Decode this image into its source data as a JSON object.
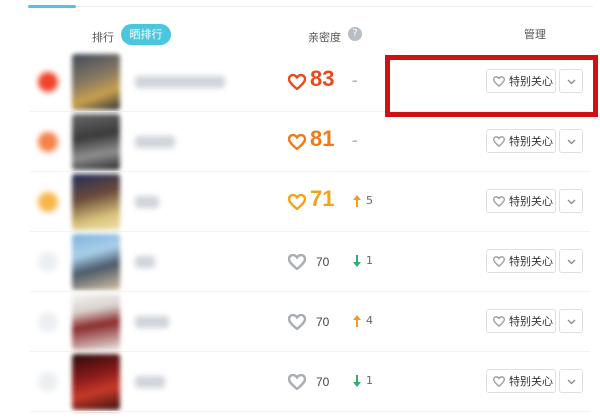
{
  "header": {
    "rank_label": "排行",
    "toggle_label": "晒排行",
    "intimacy_label": "亲密度",
    "help_icon": "?",
    "manage_label": "管理"
  },
  "colors": {
    "accent": "#4ac6df",
    "score_red": "#e84a1c",
    "score_orange": "#f07a17",
    "score_yellow": "#f2a21d",
    "heart_gray": "#a7adb3",
    "arrow_up": "#f29b1f",
    "arrow_down": "#2fae6f",
    "highlight": "#cc1212"
  },
  "rows": [
    {
      "score": "83",
      "delta": "–",
      "trend": "none",
      "tier": "red",
      "care_label": "特别关心"
    },
    {
      "score": "81",
      "delta": "–",
      "trend": "none",
      "tier": "orange",
      "care_label": "特别关心"
    },
    {
      "score": "71",
      "delta": "5",
      "trend": "up",
      "tier": "yellow",
      "care_label": "特别关心"
    },
    {
      "score": "70",
      "delta": "1",
      "trend": "down",
      "tier": "gray",
      "care_label": "特别关心"
    },
    {
      "score": "70",
      "delta": "4",
      "trend": "up",
      "tier": "gray",
      "care_label": "特别关心"
    },
    {
      "score": "70",
      "delta": "1",
      "trend": "down",
      "tier": "gray",
      "care_label": "特别关心"
    }
  ]
}
